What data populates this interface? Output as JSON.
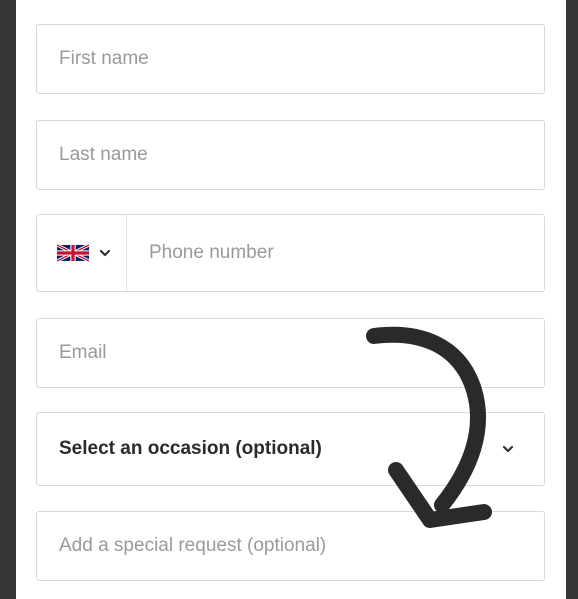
{
  "form": {
    "first_name": {
      "placeholder": "First name"
    },
    "last_name": {
      "placeholder": "Last name"
    },
    "phone": {
      "country": "United Kingdom",
      "flag_icon": "uk-flag-icon",
      "placeholder": "Phone number"
    },
    "email": {
      "placeholder": "Email"
    },
    "occasion": {
      "selected": "Select an occasion (optional)",
      "icon": "chevron-down-icon"
    },
    "special_request": {
      "placeholder": "Add a special request (optional)"
    }
  },
  "annotation": {
    "icon": "curved-arrow-icon",
    "color": "#2a2a2a"
  },
  "colors": {
    "border": "#d9d9d9",
    "placeholder": "#9a9a9a",
    "selected_text": "#2b2b2b",
    "frame": "#363636"
  }
}
